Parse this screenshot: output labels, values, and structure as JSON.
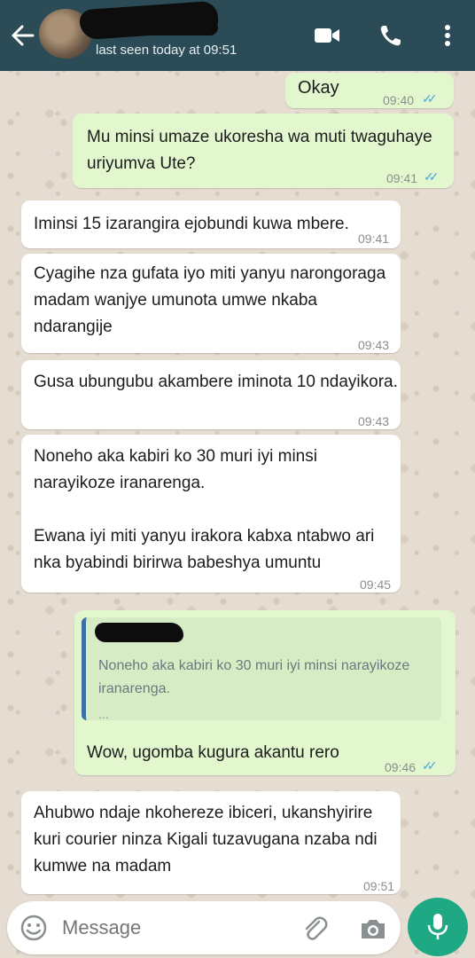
{
  "header": {
    "last_seen": "last seen today at 09:51"
  },
  "messages": [
    {
      "text": "Okay",
      "time": "09:40",
      "ticks": "✓✓"
    },
    {
      "text": "Mu minsi umaze ukoresha wa muti twaguhaye\nuriyumva Ute?",
      "time": "09:41",
      "ticks": "✓✓"
    },
    {
      "text": "Iminsi 15 izarangira ejobundi kuwa mbere.",
      "time": "09:41"
    },
    {
      "text": "Cyagihe nza gufata iyo miti yanyu narongoraga\nmadam wanjye umunota umwe nkaba\nndarangije",
      "time": "09:43"
    },
    {
      "text": "Gusa ubungubu akambere iminota 10 ndayikora.",
      "time": "09:43"
    },
    {
      "text": "Noneho aka kabiri ko 30 muri iyi minsi\nnarayikoze iranarenga.\n\nEwana iyi miti yanyu irakora kabxa ntabwo ari\nnka byabindi birirwa babeshya umuntu",
      "time": "09:45"
    },
    {
      "quote": "Noneho aka kabiri ko 30 muri iyi minsi narayikoze\niranarenga.",
      "quote_more": "...",
      "text": "Wow, ugomba kugura akantu rero",
      "time": "09:46",
      "ticks": "✓✓"
    },
    {
      "text": "Ahubwo ndaje nkohereze ibiceri, ukanshyirire\nkuri courier ninza Kigali tuzavugana nzaba ndi\nkumwe na madam",
      "time": "09:51"
    }
  ],
  "input": {
    "placeholder": "Message"
  },
  "colors": {
    "header": "#2b4c57",
    "outgoing": "#e3f7cf",
    "incoming": "#ffffff",
    "ticks": "#4fa3e0",
    "mic": "#1fa884"
  },
  "icons": [
    "back-arrow-icon",
    "video-call-icon",
    "phone-icon",
    "more-menu-icon",
    "emoji-icon",
    "attach-icon",
    "camera-icon",
    "mic-icon"
  ]
}
